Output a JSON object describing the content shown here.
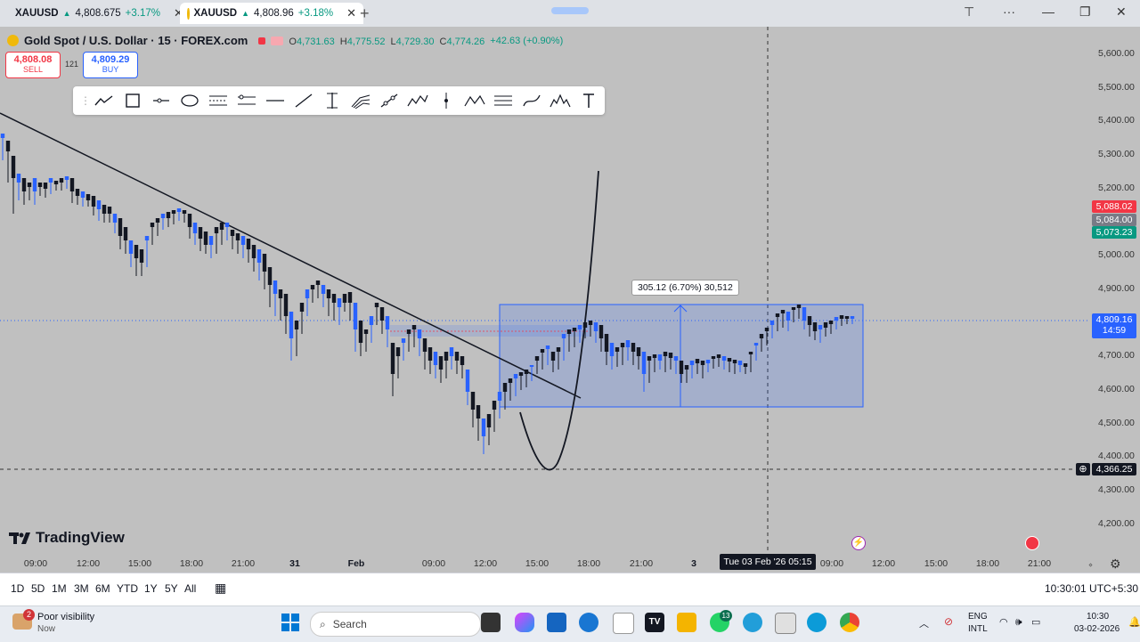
{
  "browser_tabs": [
    {
      "symbol": "XAUUSD",
      "arrow": "▲",
      "price": "4,808.675",
      "change": "+3.17%",
      "close": "✕"
    },
    {
      "symbol": "XAUUSD",
      "arrow": "▲",
      "price": "4,808.96",
      "change": "+3.18%",
      "close": "✕"
    }
  ],
  "window_controls": {
    "minimize": "—",
    "restore": "❐",
    "close": "✕"
  },
  "header": {
    "title": "Gold Spot / U.S. Dollar · 15 · FOREX.com",
    "o_label": "O",
    "o": "4,731.63",
    "h_label": "H",
    "h": "4,775.52",
    "l_label": "L",
    "l": "4,729.30",
    "c_label": "C",
    "c": "4,774.26",
    "chg": "+42.63 (+0.90%)"
  },
  "trade": {
    "sell_price": "4,808.08",
    "sell_label": "SELL",
    "spread": "121",
    "buy_price": "4,809.29",
    "buy_label": "BUY"
  },
  "price_axis": [
    "5,600.00",
    "5,500.00",
    "5,400.00",
    "5,300.00",
    "5,200.00",
    "5,000.00",
    "4,900.00",
    "4,700.00",
    "4,600.00",
    "4,500.00",
    "4,400.00",
    "4,300.00",
    "4,200.00"
  ],
  "price_tags": {
    "red": "5,088.02",
    "gray": "5,084.00",
    "green": "5,073.23",
    "current": "4,809.16",
    "countdown": "14:59",
    "crosshair": "4,366.25"
  },
  "time_axis": [
    "09:00",
    "12:00",
    "15:00",
    "18:00",
    "21:00",
    "31",
    "Feb",
    "09:00",
    "12:00",
    "15:00",
    "18:00",
    "21:00",
    "3",
    "09:00",
    "12:00",
    "15:00",
    "18:00",
    "21:00"
  ],
  "crosshair_time": "Tue 03 Feb '26   05:15",
  "measure_label": "305.12 (6.70%) 30,512",
  "logo": "TradingView",
  "ranges": [
    "1D",
    "5D",
    "1M",
    "3M",
    "6M",
    "YTD",
    "1Y",
    "5Y",
    "All"
  ],
  "clock": "10:30:01 UTC+5:30",
  "taskbar": {
    "weather_title": "Poor visibility",
    "weather_sub": "Now",
    "weather_badge": "2",
    "search": "Search",
    "whatsapp_badge": "13",
    "lang1": "ENG",
    "lang2": "INTL",
    "time": "10:30",
    "date": "03-02-2026"
  },
  "colors": {
    "up": "#2962ff",
    "down": "#131722",
    "accent": "#2962ff",
    "green": "#089981",
    "red": "#f23645"
  }
}
